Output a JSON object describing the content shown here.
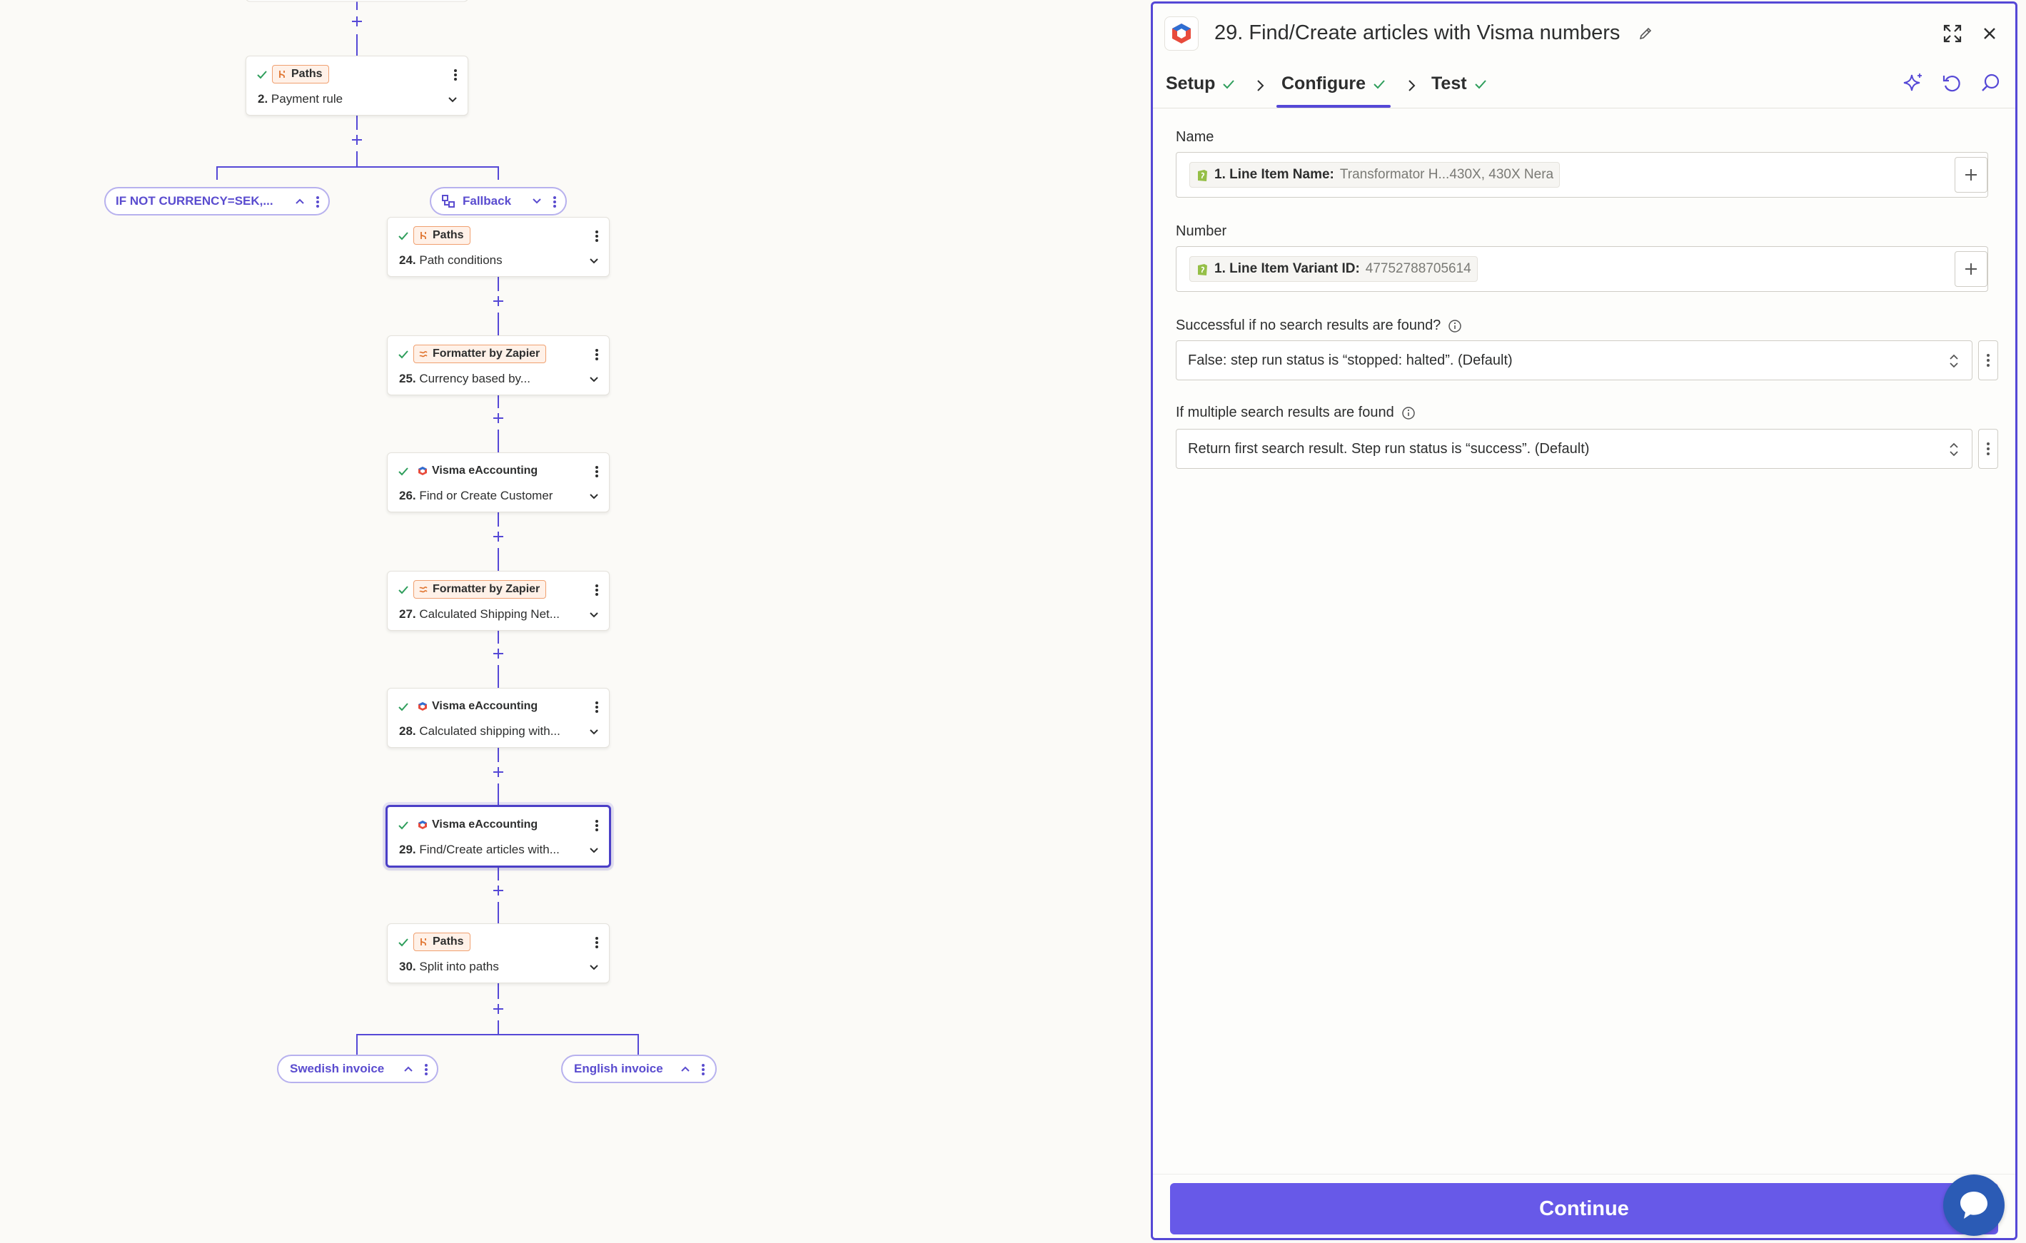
{
  "canvas": {
    "nodes": [
      {
        "app": "Paths",
        "badge_style": "orange",
        "number": "2.",
        "title": " Payment rule"
      },
      {
        "app": "Paths",
        "badge_style": "orange",
        "number": "24.",
        "title": " Path conditions"
      },
      {
        "app": "Formatter by Zapier",
        "badge_style": "orange",
        "number": "25.",
        "title": " Currency based by..."
      },
      {
        "app": "Visma eAccounting",
        "badge_style": "plain",
        "number": "26.",
        "title": " Find or Create Customer"
      },
      {
        "app": "Formatter by Zapier",
        "badge_style": "orange",
        "number": "27.",
        "title": " Calculated Shipping Net..."
      },
      {
        "app": "Visma eAccounting",
        "badge_style": "plain",
        "number": "28.",
        "title": " Calculated shipping with..."
      },
      {
        "app": "Visma eAccounting",
        "badge_style": "plain",
        "number": "29.",
        "title": " Find/Create articles with..."
      },
      {
        "app": "Paths",
        "badge_style": "orange",
        "number": "30.",
        "title": " Split into paths"
      }
    ],
    "path_pills": [
      {
        "label": "IF NOT CURRENCY=SEK,..."
      },
      {
        "label": "Fallback"
      },
      {
        "label": "Swedish invoice"
      },
      {
        "label": "English invoice"
      }
    ]
  },
  "panel": {
    "title": "29. Find/Create articles with Visma numbers",
    "steps": [
      {
        "label": "Setup"
      },
      {
        "label": "Configure"
      },
      {
        "label": "Test"
      }
    ],
    "fields": {
      "name": {
        "label": "Name",
        "token_key": "1. Line Item Name:",
        "token_value": "Transformator H...430X, 430X Nera"
      },
      "number": {
        "label": "Number",
        "token_key": "1. Line Item Variant ID:",
        "token_value": "47752788705614"
      },
      "no_results": {
        "label": "Successful if no search results are found?",
        "value": "False: step run status is “stopped: halted”. (Default)"
      },
      "multiple_results": {
        "label": "If multiple search results are found",
        "value": "Return first search result. Step run status is “success”. (Default)"
      }
    },
    "continue_label": "Continue"
  },
  "colors": {
    "accent": "#5548d6",
    "button": "#6759e8",
    "success": "#2e9e5b",
    "paths_orange": "#f0a070",
    "wire": "#5548d6"
  }
}
